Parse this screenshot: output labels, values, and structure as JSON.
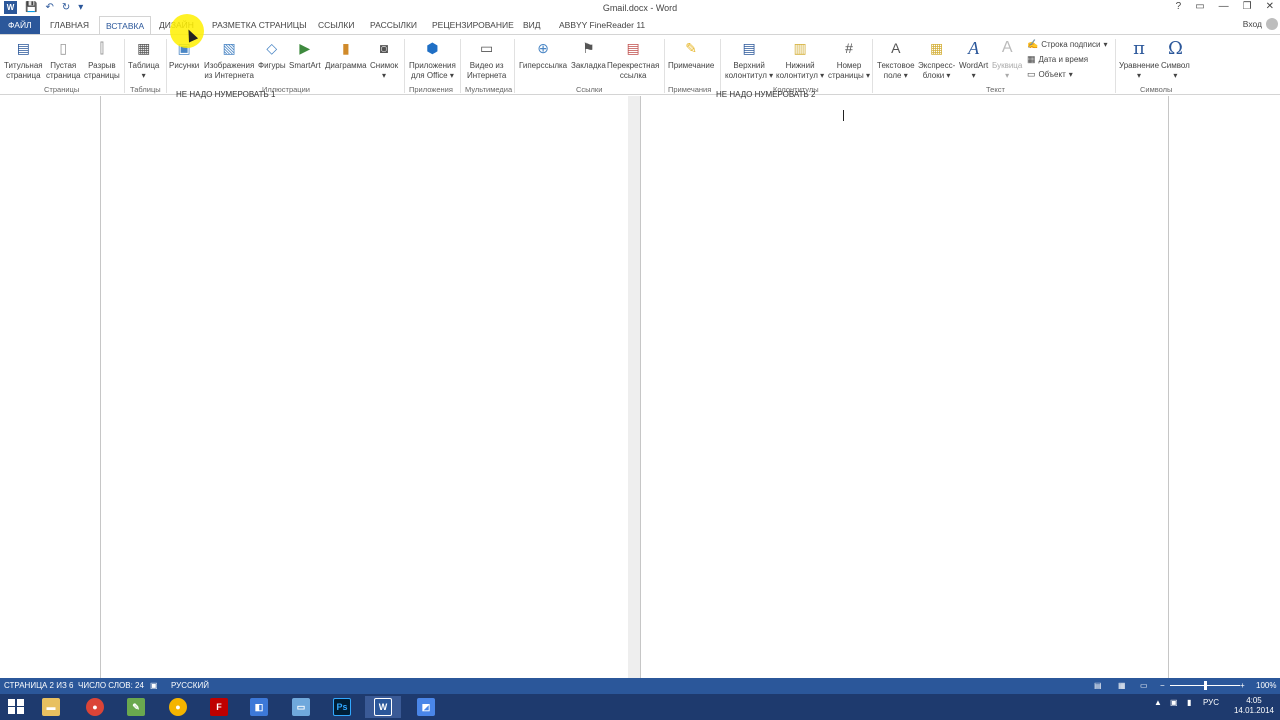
{
  "window": {
    "title": "Gmail.docx - Word",
    "signin": "Вход",
    "controls": [
      "?",
      "▭",
      "—",
      "❐",
      "✕"
    ]
  },
  "tabs": [
    {
      "label": "ФАЙЛ"
    },
    {
      "label": "ГЛАВНАЯ"
    },
    {
      "label": "ВСТАВКА"
    },
    {
      "label": "ДИЗАЙН"
    },
    {
      "label": "РАЗМЕТКА СТРАНИЦЫ"
    },
    {
      "label": "ССЫЛКИ"
    },
    {
      "label": "РАССЫЛКИ"
    },
    {
      "label": "РЕЦЕНЗИРОВАНИЕ"
    },
    {
      "label": "ВИД"
    },
    {
      "label": "ABBYY FineReader 11"
    }
  ],
  "ribbon": {
    "groups": {
      "pages": "Страницы",
      "tables": "Таблицы",
      "illustrations": "Иллюстрации",
      "apps": "Приложения",
      "media": "Мультимедиа",
      "links": "Ссылки",
      "comments": "Примечания",
      "headers": "Колонтитулы",
      "text": "Текст",
      "symbols": "Символы"
    },
    "buttons": {
      "cover_page": [
        "Титульная",
        "страница"
      ],
      "blank_page": [
        "Пустая",
        "страница"
      ],
      "page_break": [
        "Разрыв",
        "страницы"
      ],
      "table": "Таблица",
      "pictures": "Рисунки",
      "online_pictures": [
        "Изображения",
        "из Интернета"
      ],
      "shapes": "Фигуры",
      "smartart": "SmartArt",
      "chart": "Диаграмма",
      "screenshot": "Снимок",
      "apps_office": [
        "Приложения",
        "для Office"
      ],
      "online_video": [
        "Видео из",
        "Интернета"
      ],
      "hyperlink": "Гиперссылка",
      "bookmark": "Закладка",
      "cross_ref": [
        "Перекрестная",
        "ссылка"
      ],
      "comment": "Примечание",
      "header": [
        "Верхний",
        "колонтитул"
      ],
      "footer": [
        "Нижний",
        "колонтитул"
      ],
      "page_number": [
        "Номер",
        "страницы"
      ],
      "text_box": [
        "Текстовое",
        "поле"
      ],
      "quick_parts": [
        "Экспресс-",
        "блоки"
      ],
      "wordart": "WordArt",
      "dropcap": "Буквица",
      "signature_line": "Строка подписи",
      "date_time": "Дата и время",
      "object": "Объект",
      "equation": "Уравнение",
      "symbol": "Символ"
    }
  },
  "document": {
    "page1_header": "НЕ НАДО НУМЕРОВАТЬ 1",
    "page2_header": "НЕ НАДО НУМЕРОВАТЬ 2"
  },
  "status": {
    "page": "СТРАНИЦА 2 ИЗ 6",
    "words": "ЧИСЛО СЛОВ: 24",
    "language": "РУССКИЙ",
    "zoom": "100%",
    "zoom_fraction": 0.5
  },
  "taskbar": {
    "lang": "РУС",
    "time": "4:05",
    "date": "14.01.2014"
  }
}
